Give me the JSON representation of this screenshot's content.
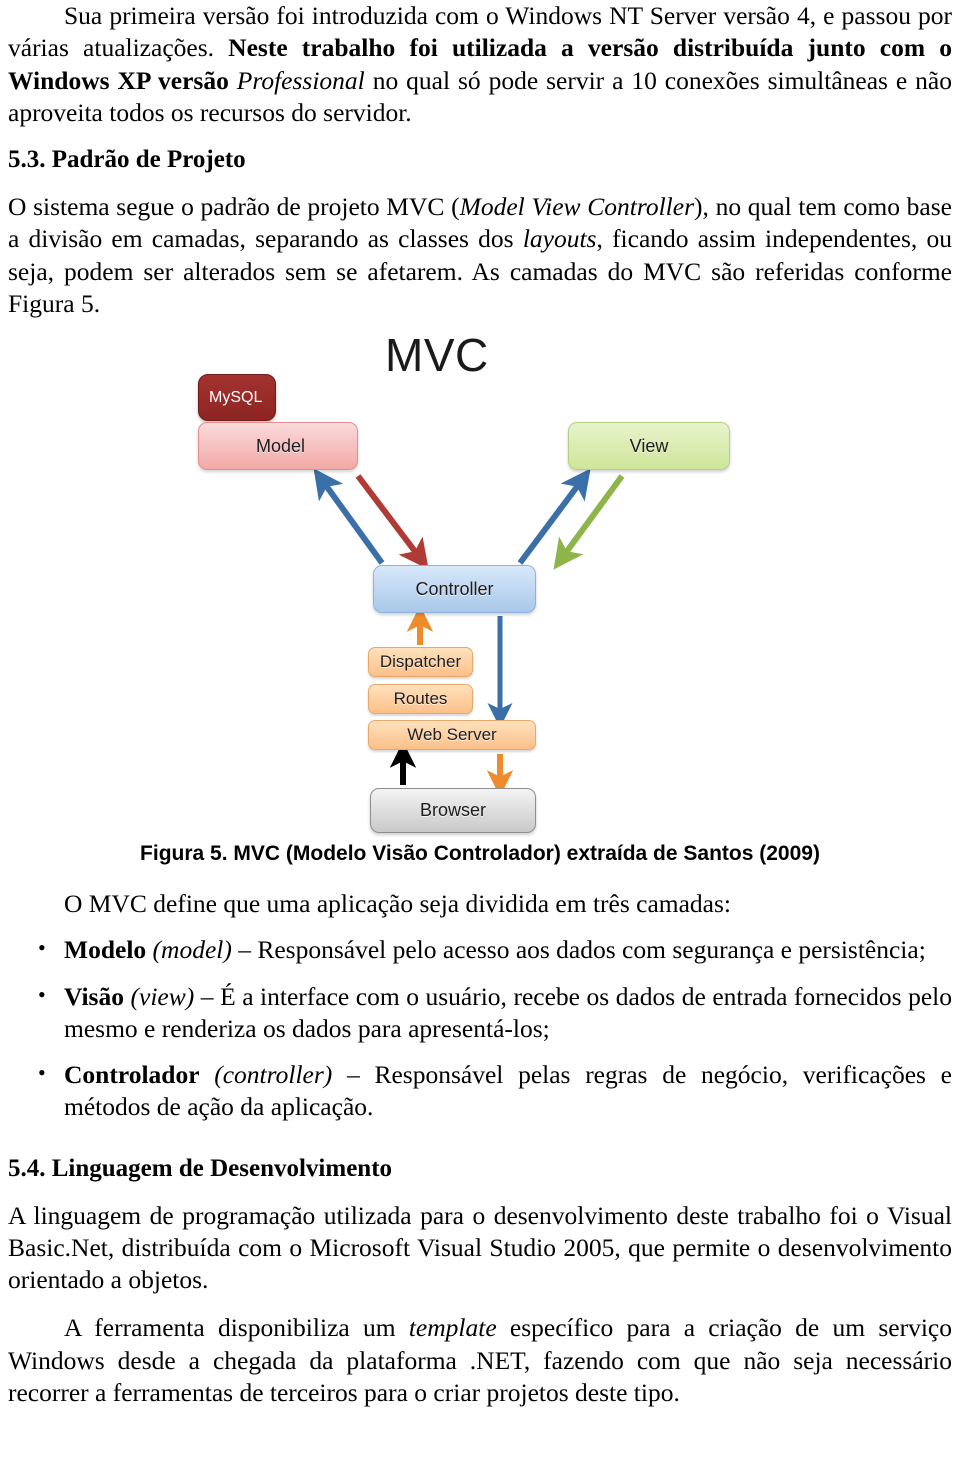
{
  "document": {
    "paragraph_1": {
      "indent_run": "Sua primeira versão foi introduzida com o Windows NT Server versão 4, e passou por várias atualizações. ",
      "bold_run": "Neste trabalho foi utilizada a versão distribuída junto com o Windows XP versão ",
      "italic_run": "Professional",
      "tail_run": " no qual só pode servir a 10 conexões simultâneas e não aproveita todos os recursos do servidor."
    },
    "heading_53": "5.3. Padrão de Projeto",
    "paragraph_2": {
      "part_1": "O sistema segue o padrão de projeto MVC (",
      "italic_1": "Model View Controller",
      "part_2": "), no qual tem como base a divisão em camadas, separando as classes dos ",
      "italic_2": "layouts",
      "part_3": ", ficando assim independentes, ou seja, podem ser alterados sem se afetarem. As camadas do MVC são referidas conforme Figura 5."
    },
    "figure": {
      "title": "MVC",
      "caption": "Figura 5. MVC (Modelo Visão Controlador) extraída de Santos (2009)",
      "nodes": {
        "mysql": "MySQL",
        "model": "Model",
        "view": "View",
        "controller": "Controller",
        "dispatcher": "Dispatcher",
        "routes": "Routes",
        "web_server": "Web Server",
        "browser": "Browser"
      },
      "colors": {
        "mysql_fill": "#8e2522",
        "model_fill": "#f2a9a7",
        "view_fill": "#cfe69a",
        "controller_fill": "#a9c8ea",
        "orange_fill": "#fcc089",
        "browser_fill": "#c9c9c9",
        "arrow_blue": "#3a6fa8",
        "arrow_red": "#b03a34",
        "arrow_green": "#8db54a",
        "arrow_orange": "#ef8b2c",
        "arrow_black": "#000000"
      },
      "arrows": [
        {
          "name": "controller-to-model",
          "color": "#3a6fa8",
          "from": "Controller",
          "to": "Model"
        },
        {
          "name": "model-to-controller",
          "color": "#b03a34",
          "from": "Model",
          "to": "Controller"
        },
        {
          "name": "controller-to-view",
          "color": "#3a6fa8",
          "from": "Controller",
          "to": "View"
        },
        {
          "name": "view-to-controller",
          "color": "#8db54a",
          "from": "View",
          "to": "Controller"
        },
        {
          "name": "dispatcher-to-controller",
          "color": "#ef8b2c",
          "from": "Dispatcher",
          "to": "Controller"
        },
        {
          "name": "controller-to-webserver",
          "color": "#3a6fa8",
          "from": "Controller",
          "to": "Web Server"
        },
        {
          "name": "browser-to-webserver",
          "color": "#000000",
          "from": "Browser",
          "to": "Web Server"
        },
        {
          "name": "webserver-to-browser",
          "color": "#ef8b2c",
          "from": "Web Server",
          "to": "Browser"
        }
      ]
    },
    "list_intro": "O MVC define que uma aplicação seja dividida em três camadas:",
    "bullet_char": "•",
    "list_items": [
      {
        "term": "Modelo",
        "italic_term": "(model)",
        "description": " – Responsável pelo acesso aos dados com segurança e persistência;"
      },
      {
        "term": "Visão",
        "italic_term": "(view)",
        "description": " – É a interface com o usuário, recebe os dados de entrada fornecidos pelo mesmo e renderiza os dados para apresentá-los;"
      },
      {
        "term": "Controlador",
        "italic_term": "(controller)",
        "description": " – Responsável pelas regras de negócio, verificações e métodos de ação da aplicação."
      }
    ],
    "heading_54": "5.4. Linguagem de Desenvolvimento",
    "paragraph_3": "A linguagem de programação utilizada para o desenvolvimento deste trabalho foi o Visual Basic.Net, distribuída com o Microsoft Visual Studio 2005, que permite o desenvolvimento orientado a objetos.",
    "paragraph_4": {
      "part_1": "A ferramenta disponibiliza um ",
      "italic_1": "template",
      "part_2": " específico para a criação de um serviço Windows desde a chegada da plataforma .NET, fazendo com que não seja necessário recorrer a ferramentas de terceiros para o criar projetos deste tipo."
    }
  }
}
